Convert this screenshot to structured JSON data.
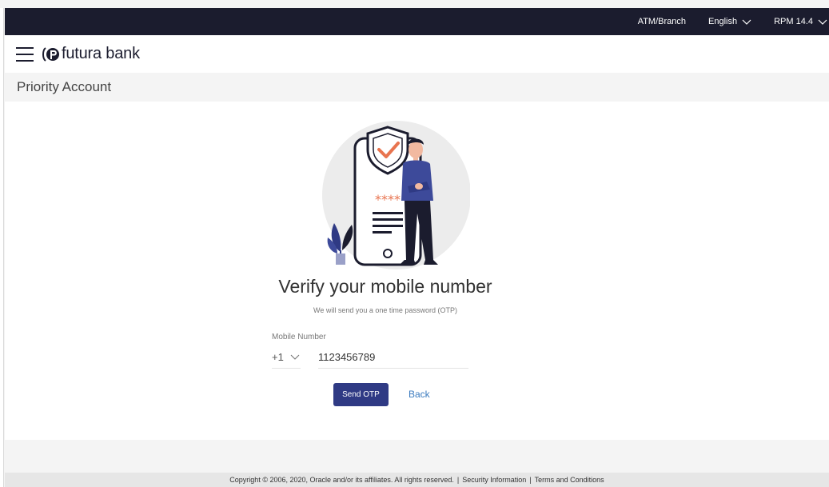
{
  "topbar": {
    "atm_branch": "ATM/Branch",
    "language": "English",
    "version": "RPM 14.4"
  },
  "header": {
    "brand": "futura bank"
  },
  "subheader": {
    "title": "Priority Account"
  },
  "verify": {
    "title": "Verify your mobile number",
    "subtitle": "We will send you a one time password (OTP)",
    "illustration_code": "****"
  },
  "form": {
    "mobile_label": "Mobile Number",
    "country_code": "+1",
    "mobile_value": "1123456789",
    "send_otp_label": "Send OTP",
    "back_label": "Back"
  },
  "footer": {
    "copyright": "Copyright © 2006, 2020, Oracle and/or its affiliates. All rights reserved.",
    "separator": "|",
    "security_info": "Security Information",
    "terms": "Terms and Conditions"
  },
  "colors": {
    "topbar_bg": "#1b1c2e",
    "primary_button": "#2f3a84",
    "link": "#3b7bbf",
    "accent_orange": "#e8744f"
  }
}
